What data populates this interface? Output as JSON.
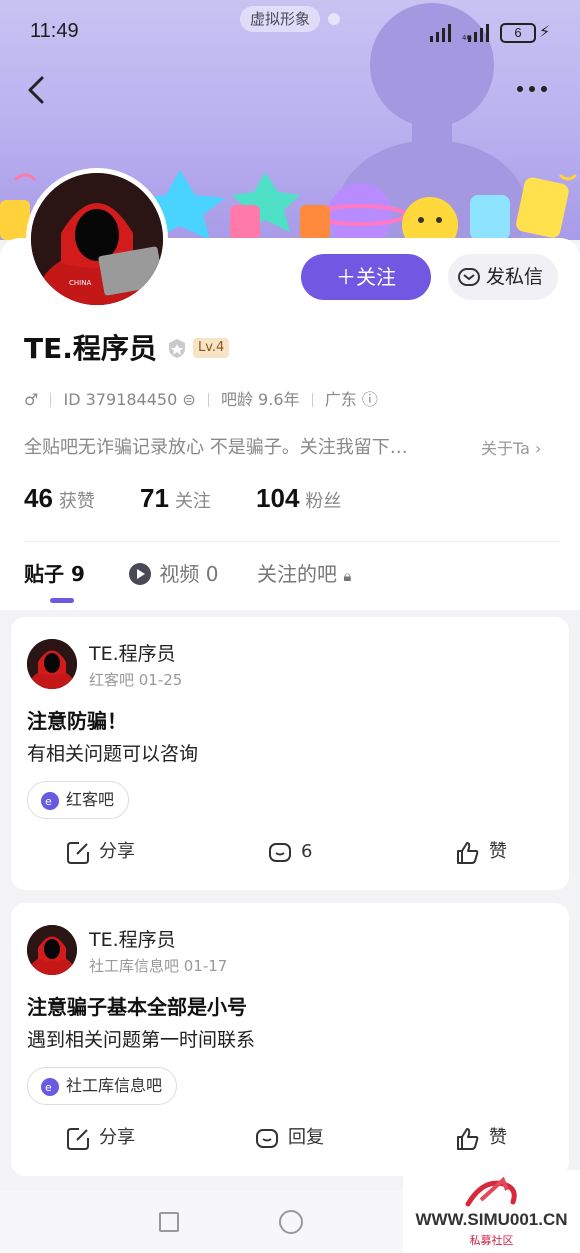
{
  "status_bar": {
    "time": "11:49",
    "pill_label": "虚拟形象",
    "battery_level": "6"
  },
  "profile": {
    "username": "TE.程序员",
    "level_badge": "Lv.4",
    "gender_icon": "male-icon",
    "id_text": "ID 379184450",
    "forum_age": "吧龄 9.6年",
    "location": "广东",
    "bio": "全贴吧无诈骗记录放心 不是骗子。关注我留下…",
    "about_link": "关于Ta",
    "follow_button": "关注",
    "dm_button": "发私信",
    "stats": [
      {
        "num": "46",
        "label": "获赞"
      },
      {
        "num": "71",
        "label": "关注"
      },
      {
        "num": "104",
        "label": "粉丝"
      }
    ]
  },
  "tabs": [
    {
      "label": "贴子 9"
    },
    {
      "label": "视频 0"
    },
    {
      "label": "关注的吧"
    }
  ],
  "posts": [
    {
      "author": "TE.程序员",
      "meta": "红客吧   01-25",
      "title": "注意防骗！",
      "body": "有相关问题可以咨询",
      "tag": "红客吧",
      "share": "分享",
      "comment": "6",
      "like": "赞"
    },
    {
      "author": "TE.程序员",
      "meta": "社工库信息吧   01-17",
      "title": "注意骗子基本全部是小号",
      "body": "遇到相关问题第一时间联系",
      "tag": "社工库信息吧",
      "share": "分享",
      "comment": "回复",
      "like": "赞"
    }
  ],
  "watermark": {
    "site": "WWW.SIMU001.CN",
    "label": "私募社区"
  },
  "colors": {
    "accent": "#7158e2",
    "banner": "#b9b0ef",
    "level_bg": "#f7e4c6"
  }
}
